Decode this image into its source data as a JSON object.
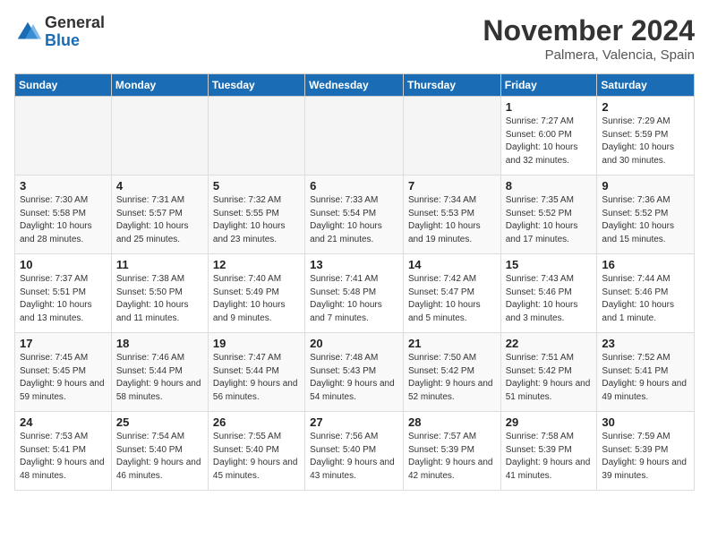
{
  "logo": {
    "general": "General",
    "blue": "Blue"
  },
  "title": "November 2024",
  "location": "Palmera, Valencia, Spain",
  "days_of_week": [
    "Sunday",
    "Monday",
    "Tuesday",
    "Wednesday",
    "Thursday",
    "Friday",
    "Saturday"
  ],
  "weeks": [
    [
      {
        "day": "",
        "empty": true
      },
      {
        "day": "",
        "empty": true
      },
      {
        "day": "",
        "empty": true
      },
      {
        "day": "",
        "empty": true
      },
      {
        "day": "",
        "empty": true
      },
      {
        "day": "1",
        "sunrise": "7:27 AM",
        "sunset": "6:00 PM",
        "daylight": "10 hours and 32 minutes."
      },
      {
        "day": "2",
        "sunrise": "7:29 AM",
        "sunset": "5:59 PM",
        "daylight": "10 hours and 30 minutes."
      }
    ],
    [
      {
        "day": "3",
        "sunrise": "7:30 AM",
        "sunset": "5:58 PM",
        "daylight": "10 hours and 28 minutes."
      },
      {
        "day": "4",
        "sunrise": "7:31 AM",
        "sunset": "5:57 PM",
        "daylight": "10 hours and 25 minutes."
      },
      {
        "day": "5",
        "sunrise": "7:32 AM",
        "sunset": "5:55 PM",
        "daylight": "10 hours and 23 minutes."
      },
      {
        "day": "6",
        "sunrise": "7:33 AM",
        "sunset": "5:54 PM",
        "daylight": "10 hours and 21 minutes."
      },
      {
        "day": "7",
        "sunrise": "7:34 AM",
        "sunset": "5:53 PM",
        "daylight": "10 hours and 19 minutes."
      },
      {
        "day": "8",
        "sunrise": "7:35 AM",
        "sunset": "5:52 PM",
        "daylight": "10 hours and 17 minutes."
      },
      {
        "day": "9",
        "sunrise": "7:36 AM",
        "sunset": "5:52 PM",
        "daylight": "10 hours and 15 minutes."
      }
    ],
    [
      {
        "day": "10",
        "sunrise": "7:37 AM",
        "sunset": "5:51 PM",
        "daylight": "10 hours and 13 minutes."
      },
      {
        "day": "11",
        "sunrise": "7:38 AM",
        "sunset": "5:50 PM",
        "daylight": "10 hours and 11 minutes."
      },
      {
        "day": "12",
        "sunrise": "7:40 AM",
        "sunset": "5:49 PM",
        "daylight": "10 hours and 9 minutes."
      },
      {
        "day": "13",
        "sunrise": "7:41 AM",
        "sunset": "5:48 PM",
        "daylight": "10 hours and 7 minutes."
      },
      {
        "day": "14",
        "sunrise": "7:42 AM",
        "sunset": "5:47 PM",
        "daylight": "10 hours and 5 minutes."
      },
      {
        "day": "15",
        "sunrise": "7:43 AM",
        "sunset": "5:46 PM",
        "daylight": "10 hours and 3 minutes."
      },
      {
        "day": "16",
        "sunrise": "7:44 AM",
        "sunset": "5:46 PM",
        "daylight": "10 hours and 1 minute."
      }
    ],
    [
      {
        "day": "17",
        "sunrise": "7:45 AM",
        "sunset": "5:45 PM",
        "daylight": "9 hours and 59 minutes."
      },
      {
        "day": "18",
        "sunrise": "7:46 AM",
        "sunset": "5:44 PM",
        "daylight": "9 hours and 58 minutes."
      },
      {
        "day": "19",
        "sunrise": "7:47 AM",
        "sunset": "5:44 PM",
        "daylight": "9 hours and 56 minutes."
      },
      {
        "day": "20",
        "sunrise": "7:48 AM",
        "sunset": "5:43 PM",
        "daylight": "9 hours and 54 minutes."
      },
      {
        "day": "21",
        "sunrise": "7:50 AM",
        "sunset": "5:42 PM",
        "daylight": "9 hours and 52 minutes."
      },
      {
        "day": "22",
        "sunrise": "7:51 AM",
        "sunset": "5:42 PM",
        "daylight": "9 hours and 51 minutes."
      },
      {
        "day": "23",
        "sunrise": "7:52 AM",
        "sunset": "5:41 PM",
        "daylight": "9 hours and 49 minutes."
      }
    ],
    [
      {
        "day": "24",
        "sunrise": "7:53 AM",
        "sunset": "5:41 PM",
        "daylight": "9 hours and 48 minutes."
      },
      {
        "day": "25",
        "sunrise": "7:54 AM",
        "sunset": "5:40 PM",
        "daylight": "9 hours and 46 minutes."
      },
      {
        "day": "26",
        "sunrise": "7:55 AM",
        "sunset": "5:40 PM",
        "daylight": "9 hours and 45 minutes."
      },
      {
        "day": "27",
        "sunrise": "7:56 AM",
        "sunset": "5:40 PM",
        "daylight": "9 hours and 43 minutes."
      },
      {
        "day": "28",
        "sunrise": "7:57 AM",
        "sunset": "5:39 PM",
        "daylight": "9 hours and 42 minutes."
      },
      {
        "day": "29",
        "sunrise": "7:58 AM",
        "sunset": "5:39 PM",
        "daylight": "9 hours and 41 minutes."
      },
      {
        "day": "30",
        "sunrise": "7:59 AM",
        "sunset": "5:39 PM",
        "daylight": "9 hours and 39 minutes."
      }
    ]
  ],
  "labels": {
    "sunrise": "Sunrise:",
    "sunset": "Sunset:",
    "daylight": "Daylight:"
  }
}
